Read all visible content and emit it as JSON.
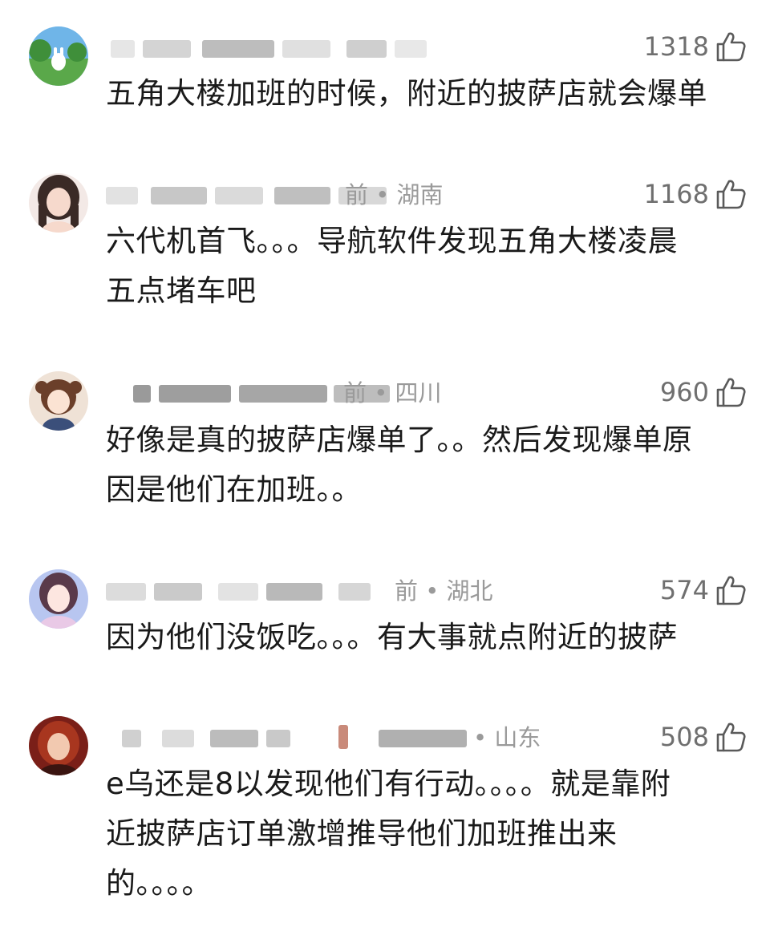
{
  "comments": [
    {
      "meta": "",
      "likes": "1318",
      "lines": [
        "五角大楼加班的时候，附近的披萨店就会爆单"
      ]
    },
    {
      "meta": "前 • 湖南",
      "likes": "1168",
      "lines": [
        "六代机首飞。。。导航软件发现五角大楼凌晨",
        "五点堵车吧"
      ]
    },
    {
      "meta": "前 • 四川",
      "likes": "960",
      "lines": [
        "好像是真的披萨店爆单了。。然后发现爆单原",
        "因是他们在加班。。"
      ]
    },
    {
      "meta": "前 • 湖北",
      "likes": "574",
      "lines": [
        "因为他们没饭吃。。。有大事就点附近的披萨"
      ]
    },
    {
      "meta": "• 山东",
      "likes": "508",
      "lines": [
        "e乌还是8以发现他们有行动。。。。就是靠附",
        "近披萨店订单激增推导他们加班推出来",
        "的。。。。"
      ]
    }
  ],
  "icons": {
    "like": "thumbs-up-icon",
    "avatar": "user-avatar"
  },
  "colors": {
    "meta_gray": "#9a9a9a",
    "like_gray": "#6f6f6f",
    "text": "#1a1a1a"
  }
}
